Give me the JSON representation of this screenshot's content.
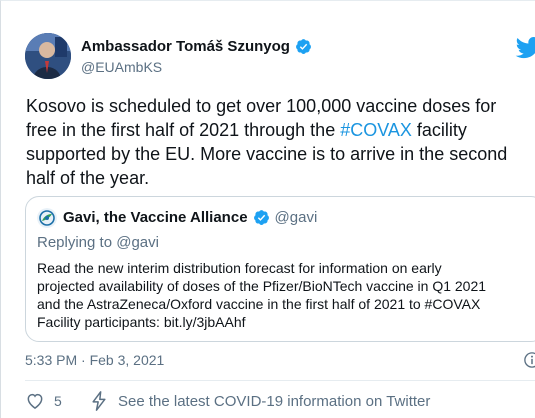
{
  "tweet": {
    "author": {
      "name": "Ambassador Tomáš Szunyog",
      "handle": "@EUAmbKS",
      "verified": true
    },
    "text_lines": [
      "Kosovo is scheduled to get over 100,000 vaccine doses for",
      "free in the first half of 2021 through the ",
      "supported by the EU. More vaccine is to arrive in the second",
      "half of the year."
    ],
    "hashtag": "#COVAX",
    "text_line2_after": " facility",
    "timestamp": "5:33 PM · Feb 3, 2021",
    "likes": "5",
    "covid_info_link": "See the latest COVID-19 information on Twitter"
  },
  "quoted_tweet": {
    "author": {
      "name": "Gavi, the Vaccine Alliance",
      "handle": "@gavi",
      "verified": true
    },
    "replying_to": "Replying to @gavi",
    "text_lines": [
      "Read the new interim distribution forecast for information on early",
      "projected availability of doses of the Pfizer/BioNTech vaccine in Q1 2021",
      "and the AstraZeneca/Oxford vaccine in the first half of 2021 to #COVAX",
      "Facility participants: bit.ly/3jbAAhf"
    ]
  },
  "colors": {
    "twitter_blue": "#1da1f2",
    "link_blue": "#1b95e0",
    "secondary_text": "#5b7083",
    "border": "#ccd6dd"
  },
  "icons": {
    "verified": "verified-badge-icon",
    "logo": "twitter-bird-icon",
    "info": "info-icon",
    "like": "heart-icon",
    "promo": "lightning-bolt-icon"
  }
}
